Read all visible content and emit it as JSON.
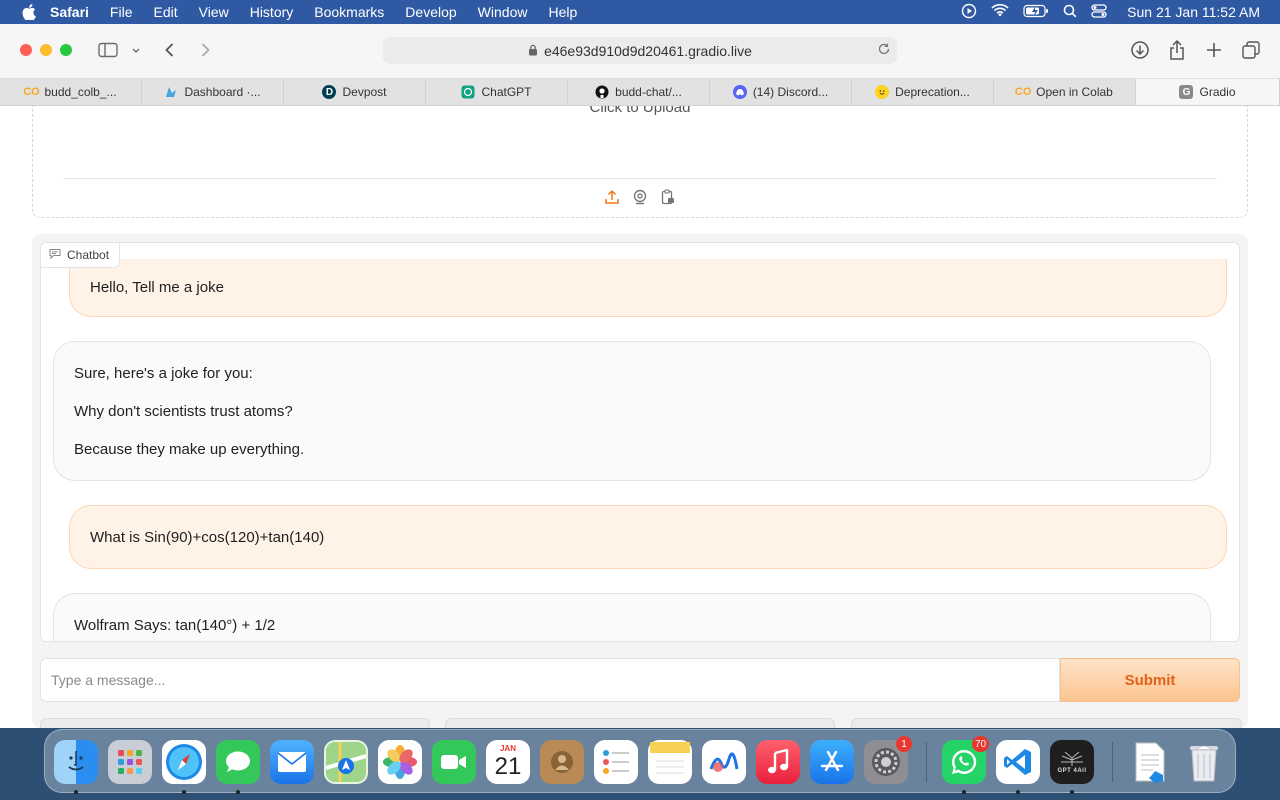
{
  "menubar": {
    "app": "Safari",
    "items": [
      "File",
      "Edit",
      "View",
      "History",
      "Bookmarks",
      "Develop",
      "Window",
      "Help"
    ],
    "clock": "Sun 21 Jan  11:52 AM"
  },
  "browser": {
    "url": "e46e93d910d9d20461.gradio.live"
  },
  "tabs": [
    {
      "label": "budd_colb_...",
      "icon": "colab-icon"
    },
    {
      "label": "Dashboard ·...",
      "icon": "dashboard-icon"
    },
    {
      "label": "Devpost",
      "icon": "devpost-icon"
    },
    {
      "label": "ChatGPT",
      "icon": "chatgpt-icon"
    },
    {
      "label": "budd-chat/...",
      "icon": "github-icon"
    },
    {
      "label": "(14) Discord...",
      "icon": "discord-icon"
    },
    {
      "label": "Deprecation...",
      "icon": "huggingface-icon"
    },
    {
      "label": "Open in Colab",
      "icon": "colab-icon"
    },
    {
      "label": "Gradio",
      "icon": "gradio-icon"
    }
  ],
  "upload": {
    "label": "Click to Upload"
  },
  "chatbot": {
    "label": "Chatbot",
    "messages": {
      "m1": "Hello, Tell me a joke",
      "m2_line1": "Sure, here's a joke for you:",
      "m2_line2": "Why don't scientists trust atoms?",
      "m2_line3": "Because they make up everything.",
      "m3": "What is Sin(90)+cos(120)+tan(140)",
      "m4": "Wolfram Says: tan(140°) + 1/2"
    }
  },
  "input": {
    "placeholder": "Type a message...",
    "submit_label": "Submit"
  },
  "dock": {
    "calendar_month": "JAN",
    "calendar_day": "21",
    "settings_badge": "1",
    "whatsapp_badge": "70",
    "gpt_label": "GPT 4All"
  },
  "colors": {
    "accent": "#e1631a",
    "user_bubble": "#fff3e8",
    "bot_bubble": "#f9fafb",
    "menubar": "#2f5aa3"
  }
}
